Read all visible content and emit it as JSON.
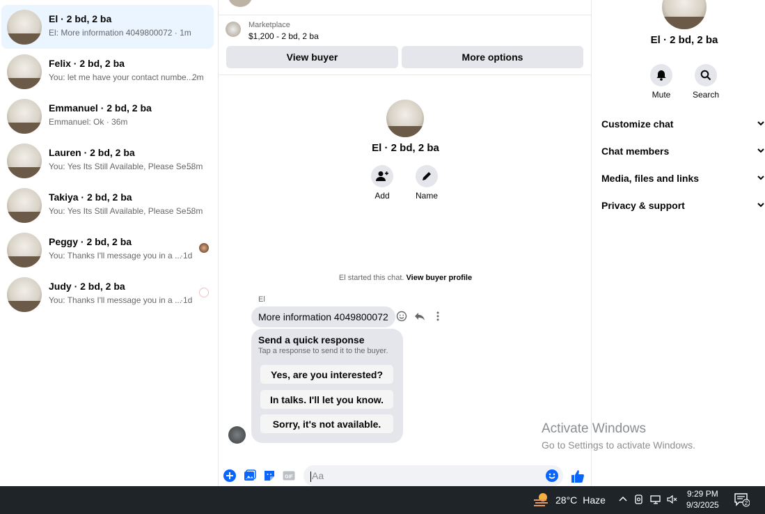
{
  "conversations": [
    {
      "name": "El · 2 bd, 2 ba",
      "preview": "El: More information 4049800072 · 1m",
      "time": "",
      "active": true
    },
    {
      "name": "Felix · 2 bd, 2 ba",
      "preview": "You: let me have your contact numbe... ·",
      "time": "2m"
    },
    {
      "name": "Emmanuel · 2 bd, 2 ba",
      "preview": "Emmanuel: Ok · 36m",
      "time": ""
    },
    {
      "name": "Lauren · 2 bd, 2 ba",
      "preview": "You: Yes Its Still Available, Please Se...",
      "time": "·58m"
    },
    {
      "name": "Takiya · 2 bd, 2 ba",
      "preview": "You: Yes Its Still Available, Please Se...",
      "time": "·58m"
    },
    {
      "name": "Peggy · 2 bd, 2 ba",
      "preview": "You: Thanks I'll message you in a ...",
      "time": "·1d"
    },
    {
      "name": "Judy · 2 bd, 2 ba",
      "preview": "You: Thanks I'll message you in a ...",
      "time": "·1d"
    }
  ],
  "marketplace": {
    "label": "Marketplace",
    "listing": "$1,200 - 2 bd, 2 ba",
    "view_buyer": "View buyer",
    "more_options": "More options"
  },
  "chat": {
    "title": "El · 2 bd, 2 ba",
    "add_label": "Add",
    "name_label": "Name",
    "started_text": "El started this chat.",
    "view_profile": "View buyer profile",
    "sender": "El",
    "message": "More information 4049800072",
    "quick_title": "Send a quick response",
    "quick_sub": "Tap a response to send it to the buyer.",
    "quick_replies": [
      "Yes, are you interested?",
      "In talks. I'll let you know.",
      "Sorry, it's not available."
    ],
    "input_placeholder": "Aa"
  },
  "panel": {
    "title": "El · 2 bd, 2 ba",
    "mute": "Mute",
    "search": "Search",
    "sections": [
      "Customize chat",
      "Chat members",
      "Media, files and links",
      "Privacy & support"
    ]
  },
  "watermark": {
    "line1": "Activate Windows",
    "line2": "Go to Settings to activate Windows."
  },
  "taskbar": {
    "temp": "28°C",
    "condition": "Haze",
    "time": "9:29 PM",
    "date": "9/3/2025",
    "notif_count": "2"
  },
  "colors": {
    "accent": "#0866ff",
    "active_row": "#ebf5ff",
    "bubble": "#e4e6eb"
  }
}
